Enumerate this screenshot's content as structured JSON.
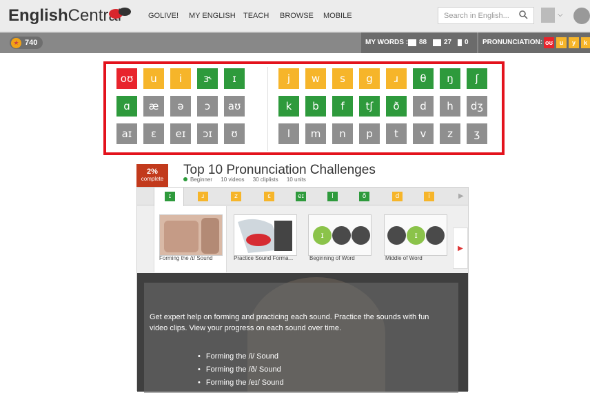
{
  "header": {
    "logo_bold": "English",
    "logo_light": "Central",
    "nav": [
      "GOLIVE!",
      "MY ENGLISH",
      "TEACH",
      "BROWSE",
      "MOBILE"
    ],
    "search_placeholder": "Search in English..."
  },
  "subbar": {
    "points": "740",
    "mywords_label": "MY WORDS :",
    "mywords_counts": [
      "88",
      "27",
      "0"
    ],
    "pronunciation_label": "PRONUNCIATION:",
    "pronunciation_chips": [
      "oʊ",
      "u",
      "y",
      "k"
    ]
  },
  "sound_grid": {
    "vowels": [
      [
        {
          "s": "oʊ",
          "c": "#e8242c"
        },
        {
          "s": "u",
          "c": "#f6b52a"
        },
        {
          "s": "i",
          "c": "#f6b52a"
        },
        {
          "s": "ɝ",
          "c": "#2e9a3c"
        },
        {
          "s": "ɪ",
          "c": "#2e9a3c"
        }
      ],
      [
        {
          "s": "ɑ",
          "c": "#2e9a3c"
        },
        {
          "s": "æ",
          "c": "#8f8f8f"
        },
        {
          "s": "ə",
          "c": "#8f8f8f"
        },
        {
          "s": "ɔ",
          "c": "#8f8f8f"
        },
        {
          "s": "aʊ",
          "c": "#8f8f8f"
        }
      ],
      [
        {
          "s": "aɪ",
          "c": "#8f8f8f"
        },
        {
          "s": "ɛ",
          "c": "#8f8f8f"
        },
        {
          "s": "eɪ",
          "c": "#8f8f8f"
        },
        {
          "s": "ɔɪ",
          "c": "#8f8f8f"
        },
        {
          "s": "ʊ",
          "c": "#8f8f8f"
        }
      ]
    ],
    "consonants": [
      [
        {
          "s": "j",
          "c": "#f6b52a"
        },
        {
          "s": "w",
          "c": "#f6b52a"
        },
        {
          "s": "s",
          "c": "#f6b52a"
        },
        {
          "s": "g",
          "c": "#f6b52a"
        },
        {
          "s": "ɹ",
          "c": "#f6b52a"
        },
        {
          "s": "θ",
          "c": "#2e9a3c"
        },
        {
          "s": "ŋ",
          "c": "#2e9a3c"
        },
        {
          "s": "ʃ",
          "c": "#2e9a3c"
        }
      ],
      [
        {
          "s": "k",
          "c": "#2e9a3c"
        },
        {
          "s": "b",
          "c": "#2e9a3c"
        },
        {
          "s": "f",
          "c": "#2e9a3c"
        },
        {
          "s": "tʃ",
          "c": "#2e9a3c"
        },
        {
          "s": "ð",
          "c": "#2e9a3c"
        },
        {
          "s": "d",
          "c": "#8f8f8f"
        },
        {
          "s": "h",
          "c": "#8f8f8f"
        },
        {
          "s": "dʒ",
          "c": "#8f8f8f"
        }
      ],
      [
        {
          "s": "l",
          "c": "#8f8f8f"
        },
        {
          "s": "m",
          "c": "#8f8f8f"
        },
        {
          "s": "n",
          "c": "#8f8f8f"
        },
        {
          "s": "p",
          "c": "#8f8f8f"
        },
        {
          "s": "t",
          "c": "#8f8f8f"
        },
        {
          "s": "v",
          "c": "#8f8f8f"
        },
        {
          "s": "z",
          "c": "#8f8f8f"
        },
        {
          "s": "ʒ",
          "c": "#8f8f8f"
        }
      ]
    ]
  },
  "course": {
    "percent": "2%",
    "percent_label": "complete",
    "title": "Top 10 Pronunciation Challenges",
    "level": "Beginner",
    "videos": "10 videos",
    "cliplists": "30 cliplists",
    "units": "10 units"
  },
  "sound_tabs": [
    {
      "s": "ɪ",
      "c": "#2e9a3c"
    },
    {
      "s": "ɹ",
      "c": "#f6b52a"
    },
    {
      "s": "z",
      "c": "#f6b52a"
    },
    {
      "s": "ɛ",
      "c": "#f6b52a"
    },
    {
      "s": "eɪ",
      "c": "#2e9a3c"
    },
    {
      "s": "l",
      "c": "#2e9a3c"
    },
    {
      "s": "ð",
      "c": "#2e9a3c"
    },
    {
      "s": "d",
      "c": "#f6b52a"
    },
    {
      "s": "i",
      "c": "#f6b52a"
    }
  ],
  "lessons": [
    {
      "label": "Forming the /ɪ/ Sound"
    },
    {
      "label": "Practice Sound Forma..."
    },
    {
      "label": "Beginning of Word"
    },
    {
      "label": "Middle of Word"
    }
  ],
  "description": "Get expert help on forming and practicing each sound. Practice the sounds with fun video clips. View your progress on each sound over time.",
  "bullets": [
    "Forming the /i/ Sound",
    "Forming the /ð/ Sound",
    "Forming the /eɪ/ Sound"
  ]
}
